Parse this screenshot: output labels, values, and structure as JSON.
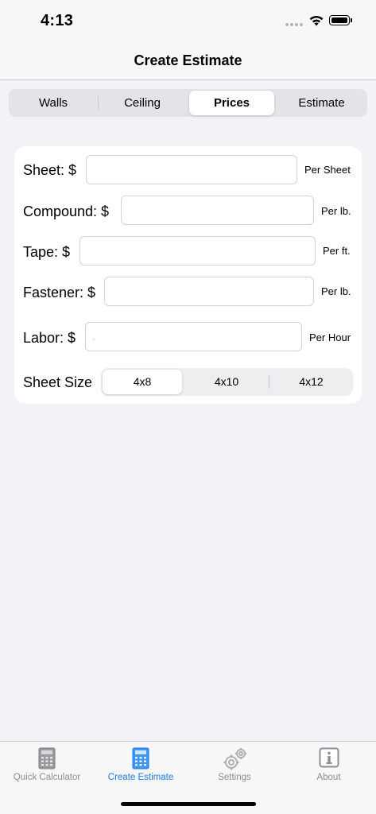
{
  "status_bar": {
    "time": "4:13"
  },
  "nav": {
    "title": "Create Estimate"
  },
  "tabs_top": {
    "items": [
      {
        "label": "Walls"
      },
      {
        "label": "Ceiling"
      },
      {
        "label": "Prices"
      },
      {
        "label": "Estimate"
      }
    ],
    "selected": "Prices"
  },
  "prices": {
    "sheet": {
      "label": "Sheet: $",
      "value": "",
      "unit": "Per Sheet"
    },
    "compound": {
      "label": "Compound: $",
      "value": "",
      "unit": "Per lb."
    },
    "tape": {
      "label": "Tape: $",
      "value": "",
      "unit": "Per ft."
    },
    "fastener": {
      "label": "Fastener: $",
      "value": "",
      "unit": "Per lb."
    },
    "labor": {
      "label": "Labor: $",
      "value": "",
      "placeholder": ".",
      "unit": "Per Hour"
    }
  },
  "sheet_size": {
    "label": "Sheet Size",
    "options": [
      "4x8",
      "4x10",
      "4x12"
    ],
    "selected": "4x8"
  },
  "tab_bar": {
    "items": [
      {
        "label": "Quick Calculator",
        "icon": "calculator-icon"
      },
      {
        "label": "Create Estimate",
        "icon": "calculator-icon"
      },
      {
        "label": "Settings",
        "icon": "gears-icon"
      },
      {
        "label": "About",
        "icon": "info-icon"
      }
    ],
    "selected": "Create Estimate"
  },
  "colors": {
    "accent": "#1a7ae6",
    "background": "#f2f2f7",
    "inactive_tab": "#8e8e93"
  }
}
